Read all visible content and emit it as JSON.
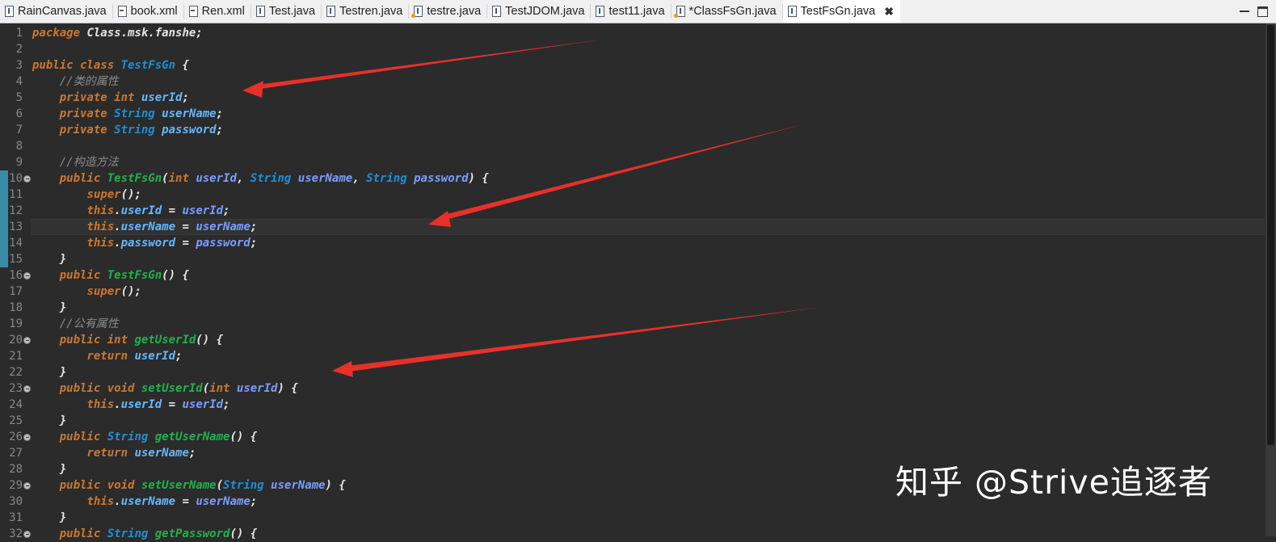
{
  "tabs": [
    {
      "label": "RainCanvas.java",
      "icon": "java-file-icon",
      "active": false
    },
    {
      "label": "book.xml",
      "icon": "xml-file-icon",
      "active": false
    },
    {
      "label": "Ren.xml",
      "icon": "xml-file-icon",
      "active": false
    },
    {
      "label": "Test.java",
      "icon": "java-file-icon",
      "active": false
    },
    {
      "label": "Testren.java",
      "icon": "java-file-icon",
      "active": false
    },
    {
      "label": "testre.java",
      "icon": "java-file-warning-icon",
      "active": false
    },
    {
      "label": "TestJDOM.java",
      "icon": "java-file-icon",
      "active": false
    },
    {
      "label": "test11.java",
      "icon": "java-file-icon",
      "active": false
    },
    {
      "label": "*ClassFsGn.java",
      "icon": "java-file-warning-icon",
      "active": false
    },
    {
      "label": "TestFsGn.java",
      "icon": "java-file-icon",
      "active": true
    }
  ],
  "active_tab_close": "✖",
  "editor": {
    "current_line": 13,
    "changed_lines": [
      10,
      15
    ],
    "fold_markers": [
      10,
      16,
      20,
      23,
      26,
      29,
      32
    ],
    "lines": [
      [
        [
          "kw",
          "package "
        ],
        [
          "plain",
          "Class.msk.fanshe;"
        ]
      ],
      [],
      [
        [
          "kw",
          "public class "
        ],
        [
          "cls",
          "TestFsGn"
        ],
        [
          "plain",
          " {"
        ]
      ],
      [
        [
          "plain",
          "    "
        ],
        [
          "comment",
          "//类的属性"
        ]
      ],
      [
        [
          "plain",
          "    "
        ],
        [
          "kw",
          "private int "
        ],
        [
          "field",
          "userId"
        ],
        [
          "plain",
          ";"
        ]
      ],
      [
        [
          "plain",
          "    "
        ],
        [
          "kw",
          "private "
        ],
        [
          "cls",
          "String "
        ],
        [
          "field",
          "userName"
        ],
        [
          "plain",
          ";"
        ]
      ],
      [
        [
          "plain",
          "    "
        ],
        [
          "kw",
          "private "
        ],
        [
          "cls",
          "String "
        ],
        [
          "field",
          "password"
        ],
        [
          "plain",
          ";"
        ]
      ],
      [],
      [
        [
          "plain",
          "    "
        ],
        [
          "comment",
          "//构造方法"
        ]
      ],
      [
        [
          "plain",
          "    "
        ],
        [
          "kw",
          "public "
        ],
        [
          "method",
          "TestFsGn"
        ],
        [
          "plain",
          "("
        ],
        [
          "kw",
          "int "
        ],
        [
          "param",
          "userId"
        ],
        [
          "plain",
          ", "
        ],
        [
          "cls",
          "String "
        ],
        [
          "param",
          "userName"
        ],
        [
          "plain",
          ", "
        ],
        [
          "cls",
          "String "
        ],
        [
          "param",
          "password"
        ],
        [
          "plain",
          ") {"
        ]
      ],
      [
        [
          "plain",
          "        "
        ],
        [
          "kw",
          "super"
        ],
        [
          "plain",
          "();"
        ]
      ],
      [
        [
          "plain",
          "        "
        ],
        [
          "kw",
          "this"
        ],
        [
          "plain",
          "."
        ],
        [
          "field",
          "userId"
        ],
        [
          "plain",
          " = "
        ],
        [
          "param",
          "userId"
        ],
        [
          "plain",
          ";"
        ]
      ],
      [
        [
          "plain",
          "        "
        ],
        [
          "kw",
          "this"
        ],
        [
          "plain",
          "."
        ],
        [
          "field",
          "userName"
        ],
        [
          "plain",
          " = "
        ],
        [
          "param",
          "userName"
        ],
        [
          "plain",
          ";"
        ]
      ],
      [
        [
          "plain",
          "        "
        ],
        [
          "kw",
          "this"
        ],
        [
          "plain",
          "."
        ],
        [
          "field",
          "password"
        ],
        [
          "plain",
          " = "
        ],
        [
          "param",
          "password"
        ],
        [
          "plain",
          ";"
        ]
      ],
      [
        [
          "plain",
          "    }"
        ]
      ],
      [
        [
          "plain",
          "    "
        ],
        [
          "kw",
          "public "
        ],
        [
          "method",
          "TestFsGn"
        ],
        [
          "plain",
          "() {"
        ]
      ],
      [
        [
          "plain",
          "        "
        ],
        [
          "kw",
          "super"
        ],
        [
          "plain",
          "();"
        ]
      ],
      [
        [
          "plain",
          "    }"
        ]
      ],
      [
        [
          "plain",
          "    "
        ],
        [
          "comment",
          "//公有属性"
        ]
      ],
      [
        [
          "plain",
          "    "
        ],
        [
          "kw",
          "public int "
        ],
        [
          "method",
          "getUserId"
        ],
        [
          "plain",
          "() {"
        ]
      ],
      [
        [
          "plain",
          "        "
        ],
        [
          "kw",
          "return "
        ],
        [
          "field",
          "userId"
        ],
        [
          "plain",
          ";"
        ]
      ],
      [
        [
          "plain",
          "    }"
        ]
      ],
      [
        [
          "plain",
          "    "
        ],
        [
          "kw",
          "public void "
        ],
        [
          "method",
          "setUserId"
        ],
        [
          "plain",
          "("
        ],
        [
          "kw",
          "int "
        ],
        [
          "param",
          "userId"
        ],
        [
          "plain",
          ") {"
        ]
      ],
      [
        [
          "plain",
          "        "
        ],
        [
          "kw",
          "this"
        ],
        [
          "plain",
          "."
        ],
        [
          "field",
          "userId"
        ],
        [
          "plain",
          " = "
        ],
        [
          "param",
          "userId"
        ],
        [
          "plain",
          ";"
        ]
      ],
      [
        [
          "plain",
          "    }"
        ]
      ],
      [
        [
          "plain",
          "    "
        ],
        [
          "kw",
          "public "
        ],
        [
          "cls",
          "String "
        ],
        [
          "method",
          "getUserName"
        ],
        [
          "plain",
          "() {"
        ]
      ],
      [
        [
          "plain",
          "        "
        ],
        [
          "kw",
          "return "
        ],
        [
          "field",
          "userName"
        ],
        [
          "plain",
          ";"
        ]
      ],
      [
        [
          "plain",
          "    }"
        ]
      ],
      [
        [
          "plain",
          "    "
        ],
        [
          "kw",
          "public void "
        ],
        [
          "method",
          "setUserName"
        ],
        [
          "plain",
          "("
        ],
        [
          "cls",
          "String "
        ],
        [
          "param",
          "userName"
        ],
        [
          "plain",
          ") {"
        ]
      ],
      [
        [
          "plain",
          "        "
        ],
        [
          "kw",
          "this"
        ],
        [
          "plain",
          "."
        ],
        [
          "field",
          "userName"
        ],
        [
          "plain",
          " = "
        ],
        [
          "param",
          "userName"
        ],
        [
          "plain",
          ";"
        ]
      ],
      [
        [
          "plain",
          "    }"
        ]
      ],
      [
        [
          "plain",
          "    "
        ],
        [
          "kw",
          "public "
        ],
        [
          "cls",
          "String "
        ],
        [
          "method",
          "getPassword"
        ],
        [
          "plain",
          "() {"
        ]
      ]
    ]
  },
  "watermark": "知乎 @Strive追逐者",
  "colors": {
    "background": "#2b2b2b",
    "keyword": "#cc7832",
    "class": "#1f8fd6",
    "method": "#1fb34a",
    "field": "#66b8ff",
    "param": "#7a9fff",
    "comment": "#8a8a8a",
    "arrow": "#e8302a",
    "change_bar": "#3b8aa8"
  }
}
